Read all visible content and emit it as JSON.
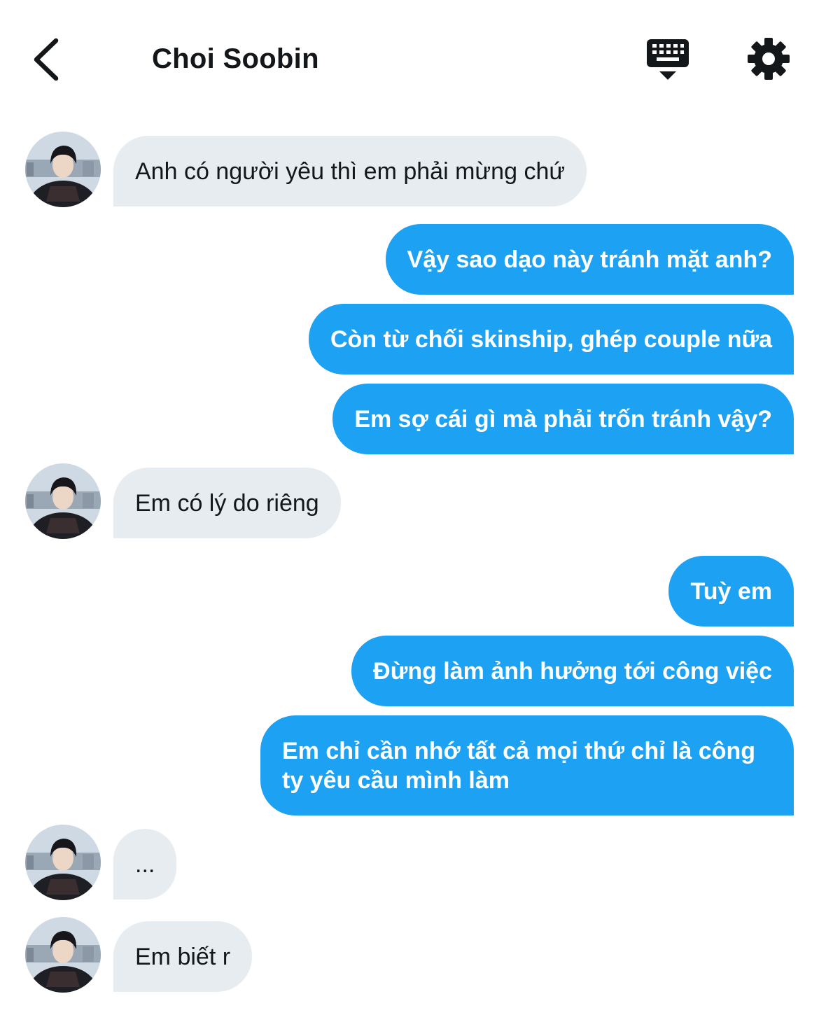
{
  "header": {
    "title": "Choi Soobin"
  },
  "icons": {
    "back": "back-chevron-icon",
    "keyboard": "keyboard-icon",
    "settings": "gear-icon"
  },
  "colors": {
    "outgoing_bubble": "#1da1f2",
    "incoming_bubble": "#e6ecf0",
    "text": "#14171a"
  },
  "messages": [
    {
      "sender": "Choi Soobin",
      "direction": "incoming",
      "text": "Anh có người yêu thì em phải mừng chứ"
    },
    {
      "direction": "outgoing",
      "text": "Vậy sao dạo này tránh mặt anh?"
    },
    {
      "direction": "outgoing",
      "text": "Còn từ chối skinship, ghép couple nữa"
    },
    {
      "direction": "outgoing",
      "text": "Em sợ cái gì mà phải trốn tránh vậy?"
    },
    {
      "sender": "Choi Soobin",
      "direction": "incoming",
      "text": "Em có lý do riêng"
    },
    {
      "direction": "outgoing",
      "text": "Tuỳ em"
    },
    {
      "direction": "outgoing",
      "text": "Đừng làm ảnh hưởng tới công việc"
    },
    {
      "direction": "outgoing",
      "text": "Em chỉ cần nhớ tất cả mọi thứ chỉ là công ty yêu cầu mình làm"
    },
    {
      "sender": "Choi Soobin",
      "direction": "incoming",
      "text": "..."
    },
    {
      "sender": "Choi Soobin",
      "direction": "incoming",
      "text": "Em biết r"
    }
  ]
}
